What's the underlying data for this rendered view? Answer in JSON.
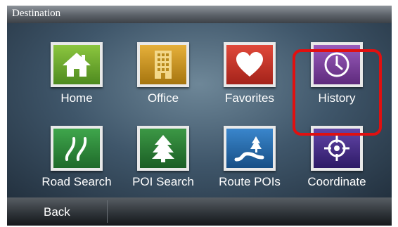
{
  "title": "Destination",
  "tiles": [
    {
      "label": "Home",
      "icon": "home-icon",
      "color": "#6aa22a"
    },
    {
      "label": "Office",
      "icon": "office-building-icon",
      "color": "#c8961e"
    },
    {
      "label": "Favorites",
      "icon": "heart-icon",
      "color": "#c0392b"
    },
    {
      "label": "History",
      "icon": "clock-icon",
      "color": "#7a3e98"
    },
    {
      "label": "Road Search",
      "icon": "road-icon",
      "color": "#2f8a3a"
    },
    {
      "label": "POI Search",
      "icon": "tree-icon",
      "color": "#2e7d36"
    },
    {
      "label": "Route POIs",
      "icon": "route-icon",
      "color": "#2468a8"
    },
    {
      "label": "Coordinate",
      "icon": "crosshair-icon",
      "color": "#4a2f8c"
    }
  ],
  "highlighted_tile": "History",
  "highlight_color": "#e01010",
  "back_label": "Back"
}
